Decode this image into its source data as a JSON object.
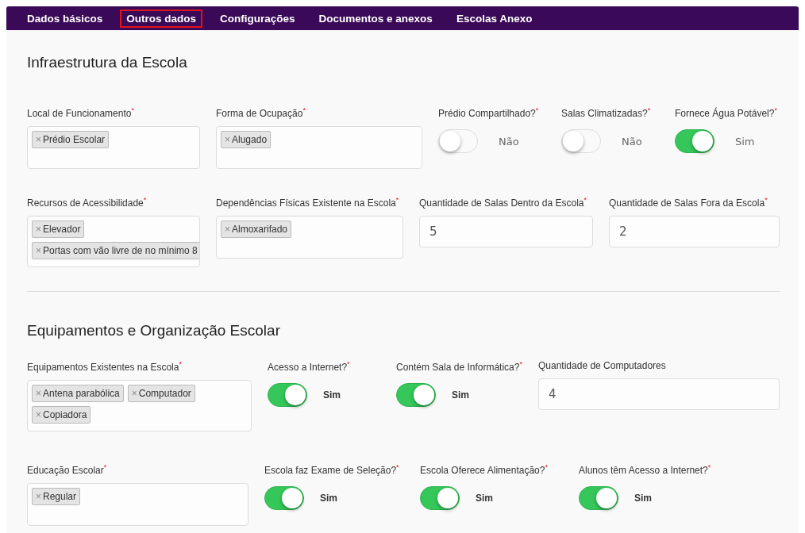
{
  "tabs": [
    {
      "label": "Dados básicos",
      "selected": false
    },
    {
      "label": "Outros dados",
      "selected": true
    },
    {
      "label": "Configurações",
      "selected": false
    },
    {
      "label": "Documentos e anexos",
      "selected": false
    },
    {
      "label": "Escolas Anexo",
      "selected": false
    }
  ],
  "sections": [
    {
      "title": "Infraestrutura da Escola",
      "rows": [
        {
          "fields": [
            {
              "kind": "tags",
              "label": "Local de Funcionamento$^{*}$",
              "tags": [
                {
                  "label": "Prédio Escolar",
                  "remove": "×"
                }
              ]
            },
            {
              "kind": "tags",
              "label": "Forma de Ocupação$^{*}$",
              "tags": [
                {
                  "label": "Alugado",
                  "remove": "×"
                }
              ]
            },
            {
              "kind": "toggle",
              "label": "Prédio Compartilhado?$^{*}$",
              "on": false,
              "state_label": "Não"
            },
            {
              "kind": "toggle",
              "label": "Salas Climatizadas?$^{*}$",
              "on": false,
              "state_label": "Não"
            },
            {
              "kind": "toggle",
              "label": "Fornece Água Potável?$^{*}$",
              "on": true,
              "state_label": "Sim"
            }
          ]
        },
        {
          "fields": [
            {
              "kind": "tags",
              "label": "Recursos de Acessibilidade$^{*}$",
              "tags": [
                {
                  "label": "Elevador",
                  "remove": "×"
                },
                {
                  "label": "Portas com vão livre de no mínimo 8",
                  "remove": "×"
                }
              ]
            },
            {
              "kind": "tags",
              "label": "Dependências Físicas Existente na Escola$^{*}$",
              "tags": [
                {
                  "label": "Almoxarifado",
                  "remove": "×"
                }
              ]
            },
            {
              "kind": "number",
              "label": "Quantidade de Salas Dentro da Escola$^{*}$",
              "value": "5"
            },
            {
              "kind": "number",
              "label": "Quantidade de Salas Fora da Escola$^{*}$",
              "value": "2"
            }
          ]
        }
      ]
    },
    {
      "title": "Equipamentos e Organização Escolar",
      "rows": [
        {
          "fields": [
            {
              "kind": "tags",
              "label": "Equipamentos Existentes na Escola$^{*}$",
              "tags": [
                {
                  "label": "Antena parabólica",
                  "remove": "×"
                },
                {
                  "label": "Computador",
                  "remove": "×"
                },
                {
                  "label": "Copiadora",
                  "remove": "×"
                }
              ]
            },
            {
              "kind": "toggle",
              "label": "Acesso a Internet?$^{*}$",
              "on": true,
              "state_label": "Sim"
            },
            {
              "kind": "toggle",
              "label": "Contém Sala de Informática?$^{*}$",
              "on": true,
              "state_label": "Sim"
            },
            {
              "kind": "number",
              "label": "Quantidade de Computadores",
              "value": "4"
            }
          ]
        },
        {
          "fields": [
            {
              "kind": "tags",
              "label": "Educação Escolar$^{*}$",
              "tags": [
                {
                  "label": "Regular",
                  "remove": "×"
                }
              ]
            },
            {
              "kind": "toggle",
              "label": "Escola faz Exame de Seleção?$^{*}$",
              "on": true,
              "state_label": "Sim"
            },
            {
              "kind": "toggle",
              "label": "Escola Oferece Alimentação?$^{*}$",
              "on": true,
              "state_label": "Sim"
            },
            {
              "kind": "toggle",
              "label": "Alunos têm Acesso a Internet?$^{*}$",
              "on": true,
              "state_label": "Sim"
            }
          ]
        }
      ]
    }
  ]
}
